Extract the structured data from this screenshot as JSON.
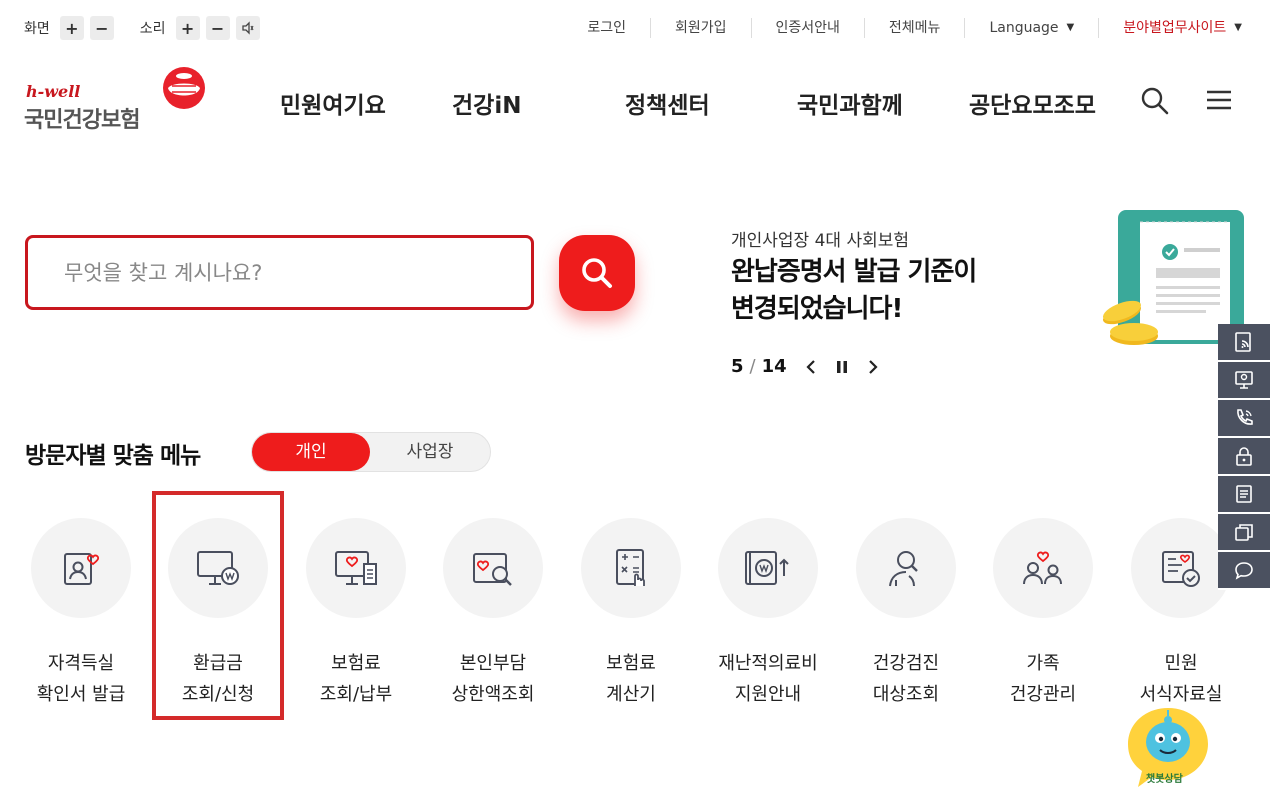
{
  "a11y": {
    "screen_label": "화면",
    "sound_label": "소리",
    "plus": "+",
    "minus": "−"
  },
  "utility_menu": {
    "login": "로그인",
    "signup": "회원가입",
    "certificate": "인증서안내",
    "all_menu": "전체메뉴",
    "language": "Language",
    "field_sites": "분야별업무사이트"
  },
  "logo": {
    "brand": "h-well",
    "name": "국민건강보험"
  },
  "gnb": [
    "민원여기요",
    "건강iN",
    "정책센터",
    "국민과함께",
    "공단요모조모"
  ],
  "search": {
    "placeholder": "무엇을 찾고 계시나요?"
  },
  "banner": {
    "subtitle": "개인사업장 4대 사회보험",
    "title_line1": "완납증명서 발급 기준이",
    "title_line2": "변경되었습니다!",
    "current": "5",
    "separator": "/",
    "total": "14"
  },
  "visitor_menu": {
    "title": "방문자별 맞춤 메뉴",
    "tab_personal": "개인",
    "tab_business": "사업장",
    "items": [
      {
        "label": "자격득실\n확인서 발급",
        "icon": "id-card-heart-icon"
      },
      {
        "label": "환급금\n조회/신청",
        "icon": "monitor-won-icon"
      },
      {
        "label": "보험료\n조회/납부",
        "icon": "monitor-receipt-icon"
      },
      {
        "label": "본인부담\n상한액조회",
        "icon": "image-search-icon"
      },
      {
        "label": "보험료\n계산기",
        "icon": "calculator-hand-icon"
      },
      {
        "label": "재난적의료비\n지원안내",
        "icon": "wallet-won-icon"
      },
      {
        "label": "건강검진\n대상조회",
        "icon": "person-search-icon"
      },
      {
        "label": "가족\n건강관리",
        "icon": "family-heart-icon"
      },
      {
        "label": "민원\n서식자료실",
        "icon": "document-check-icon"
      }
    ]
  },
  "quickbar": [
    "document-wifi-icon",
    "monitor-person-icon",
    "phone-call-icon",
    "lock-icon",
    "document-lines-icon",
    "copy-icon",
    "chat-bubble-icon"
  ],
  "chatbot": {
    "label": "챗봇상담"
  },
  "colors": {
    "brand_red": "#ee1c1c",
    "border_red": "#c8171e",
    "quickbar_bg": "#4b5160",
    "icon_gray": "#4a4f5e"
  }
}
